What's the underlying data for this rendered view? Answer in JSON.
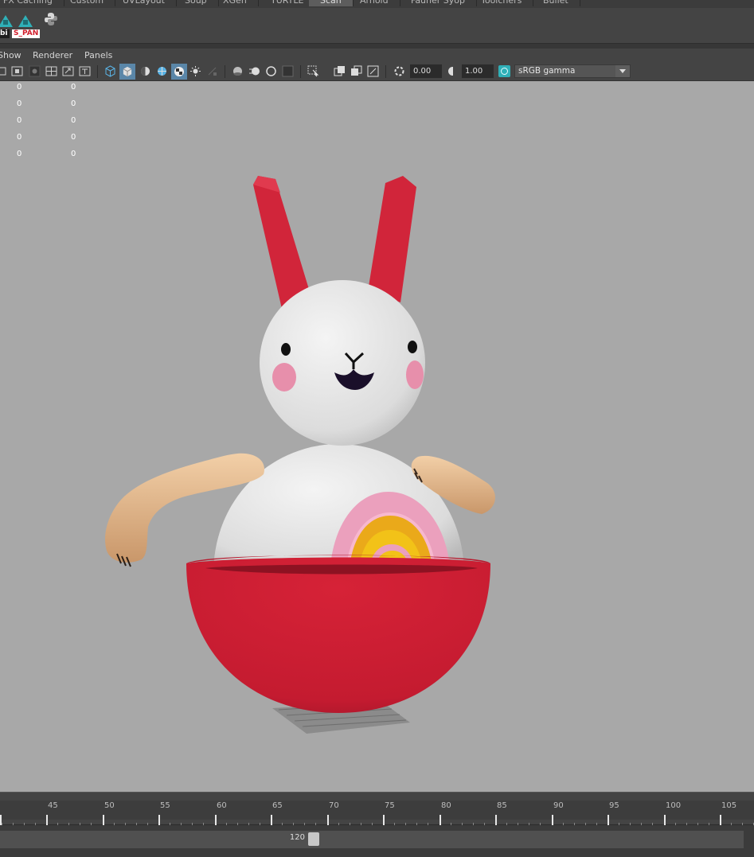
{
  "shelf_tabs": [
    "FX Caching",
    "Custom",
    "UVLayout",
    "Soup",
    "XGen",
    "TURTLE",
    "Scan",
    "Arnold",
    "Fauner Syop",
    "Toolchers",
    "Bullet"
  ],
  "shelf_tab_active_index": 6,
  "shelf": {
    "buttons": [
      {
        "label": "bi",
        "icon": "teal-shelf-icon"
      },
      {
        "label": "S_PAN",
        "icon": "teal-shelf-icon"
      },
      {
        "label": "",
        "icon": "python-icon"
      }
    ]
  },
  "panel_menu": [
    "Show",
    "Renderer",
    "Panels"
  ],
  "toolbar": {
    "exposure": "0.00",
    "gamma": "1.00",
    "color_space": "sRGB gamma"
  },
  "hud": {
    "columns": [
      [
        "0",
        "0",
        "0",
        "0",
        "0"
      ],
      [
        "0",
        "0",
        "0",
        "0",
        "0"
      ]
    ]
  },
  "timeline": {
    "ticks": [
      "45",
      "50",
      "55",
      "60",
      "65",
      "70",
      "75",
      "80",
      "85",
      "90",
      "95",
      "100",
      "105"
    ],
    "range_end": "120"
  },
  "colors": {
    "viewport_bg": "#a8a8a8",
    "ui_dark": "#444444",
    "accent_teal": "#2fb0b8",
    "bunny_red": "#cf1e35",
    "bunny_white": "#e0e0e0",
    "bunny_pink": "#eba0bd",
    "bunny_yellow": "#f2c218",
    "bunny_arm": "#e3b98f"
  }
}
